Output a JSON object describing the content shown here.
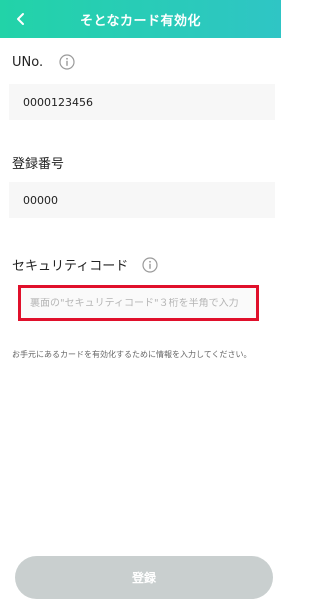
{
  "header": {
    "title": "そとなカード有効化"
  },
  "form": {
    "uno": {
      "label": "UNo.",
      "value": "0000123456"
    },
    "registration": {
      "label": "登録番号",
      "value": "00000"
    },
    "security": {
      "label": "セキュリティコード",
      "placeholder": "裏面の\"セキュリティコード\"３桁を半角で入力"
    },
    "note": "お手元にあるカードを有効化するために情報を入力してください。"
  },
  "submit": {
    "label": "登録"
  },
  "colors": {
    "header_gradient_start": "#22d3a8",
    "header_gradient_end": "#2fc5c5",
    "highlight_border": "#e0102b",
    "button_disabled": "#c9cfcf"
  }
}
